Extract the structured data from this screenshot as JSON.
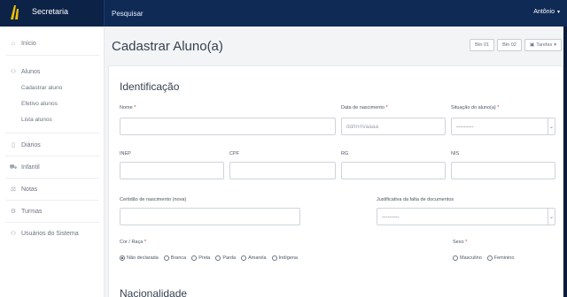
{
  "topbar": {
    "brand": "Secretaria",
    "search_placeholder": "Pesquisar",
    "user": "Antônio",
    "user_caret": "▾"
  },
  "sidebar": {
    "items": [
      {
        "icon": "⌂",
        "label": "Início"
      },
      {
        "icon": "⚇",
        "label": "Alunos"
      },
      {
        "icon": "▯",
        "label": "Diários"
      },
      {
        "icon": "⛟",
        "label": "Infantil"
      },
      {
        "icon": "⚖",
        "label": "Notas"
      },
      {
        "icon": "⚙",
        "label": "Turmas"
      },
      {
        "icon": "⚇",
        "label": "Usuários do Sistema"
      }
    ],
    "subitems": [
      "Cadastrar aluno",
      "Efetivo alunos",
      "Lista alunos"
    ]
  },
  "page": {
    "title": "Cadastrar Aluno(a)",
    "btn1": "Btn 01",
    "btn2": "Btn 02",
    "tasks": "Tarefas",
    "tasks_caret": "▾",
    "tasks_icon": "▣"
  },
  "form": {
    "section1": "Identificação",
    "nome_label": "Nome",
    "nascimento_label": "Data de nascimento",
    "nascimento_placeholder": "dd/mm/aaaa",
    "situacao_label": "Situação do aluno(a)",
    "situacao_value": "---------",
    "inep_label": "INEP",
    "cpf_label": "CPF",
    "rg_label": "RG",
    "nis_label": "NIS",
    "certidao_label": "Certidão de nascimento (nova)",
    "justificativa_label": "Justificativa da falta de documentos",
    "justificativa_value": "---------",
    "cor_label": "Cor / Raça",
    "cor_options": [
      "Não declarada",
      "Branca",
      "Preta",
      "Parda",
      "Amarela",
      "Indígena"
    ],
    "cor_selected": "Não declarada",
    "sexo_label": "Sexo",
    "sexo_options": [
      "Masculino",
      "Feminino"
    ],
    "section2": "Nacionalidade",
    "required_mark": "*",
    "select_arrow": "⌄"
  }
}
